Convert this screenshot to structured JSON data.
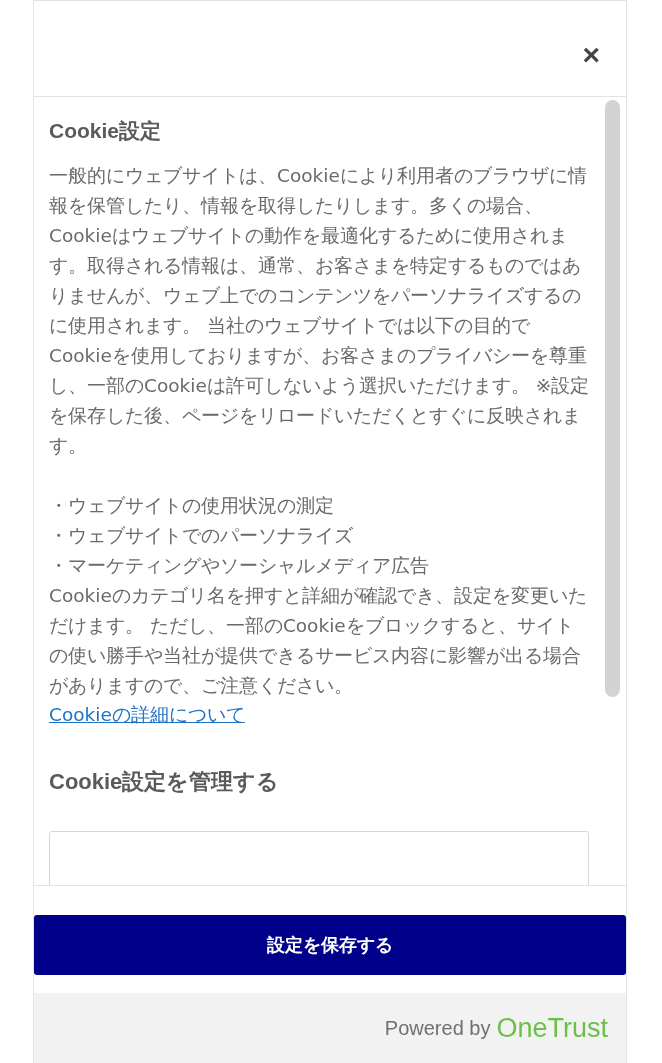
{
  "close_button": {
    "label": "×"
  },
  "title": "Cookie設定",
  "intro": "一般的にウェブサイトは、Cookieにより利用者のブラウザに情報を保管したり、情報を取得したりします。多くの場合、Cookieはウェブサイトの動作を最適化するために使用されます。取得される情報は、通常、お客さまを特定するものではありませんが、ウェブ上でのコンテンツをパーソナライズするのに使用されます。 当社のウェブサイトでは以下の目的でCookieを使用しておりますが、お客さまのプライバシーを尊重し、一部のCookieは許可しないよう選択いただけます。 ※設定を保存した後、ページをリロードいただくとすぐに反映されます。",
  "purposes": [
    "・ウェブサイトの使用状況の測定",
    "・ウェブサイトでのパーソナライズ",
    "・マーケティングやソーシャルメディア広告"
  ],
  "note": "Cookieのカテゴリ名を押すと詳細が確認でき、設定を変更いただけます。 ただし、一部のCookieをブロックすると、サイトの使い勝手や当社が提供できるサービス内容に影響が出る場合がありますので、ご注意ください。",
  "details_link": "Cookieの詳細について",
  "manage_title": "Cookie設定を管理する",
  "save_button": "設定を保存する",
  "footer": {
    "powered_by": "Powered by",
    "brand": "OneTrust"
  }
}
